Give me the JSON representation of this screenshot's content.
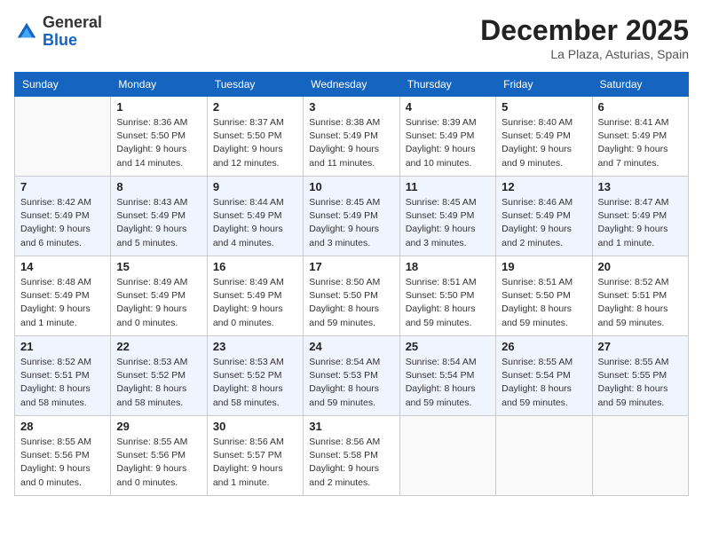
{
  "header": {
    "logo_general": "General",
    "logo_blue": "Blue",
    "month_title": "December 2025",
    "location": "La Plaza, Asturias, Spain"
  },
  "days_of_week": [
    "Sunday",
    "Monday",
    "Tuesday",
    "Wednesday",
    "Thursday",
    "Friday",
    "Saturday"
  ],
  "weeks": [
    [
      {
        "day": "",
        "sunrise": "",
        "sunset": "",
        "daylight": ""
      },
      {
        "day": "1",
        "sunrise": "Sunrise: 8:36 AM",
        "sunset": "Sunset: 5:50 PM",
        "daylight": "Daylight: 9 hours and 14 minutes."
      },
      {
        "day": "2",
        "sunrise": "Sunrise: 8:37 AM",
        "sunset": "Sunset: 5:50 PM",
        "daylight": "Daylight: 9 hours and 12 minutes."
      },
      {
        "day": "3",
        "sunrise": "Sunrise: 8:38 AM",
        "sunset": "Sunset: 5:49 PM",
        "daylight": "Daylight: 9 hours and 11 minutes."
      },
      {
        "day": "4",
        "sunrise": "Sunrise: 8:39 AM",
        "sunset": "Sunset: 5:49 PM",
        "daylight": "Daylight: 9 hours and 10 minutes."
      },
      {
        "day": "5",
        "sunrise": "Sunrise: 8:40 AM",
        "sunset": "Sunset: 5:49 PM",
        "daylight": "Daylight: 9 hours and 9 minutes."
      },
      {
        "day": "6",
        "sunrise": "Sunrise: 8:41 AM",
        "sunset": "Sunset: 5:49 PM",
        "daylight": "Daylight: 9 hours and 7 minutes."
      }
    ],
    [
      {
        "day": "7",
        "sunrise": "Sunrise: 8:42 AM",
        "sunset": "Sunset: 5:49 PM",
        "daylight": "Daylight: 9 hours and 6 minutes."
      },
      {
        "day": "8",
        "sunrise": "Sunrise: 8:43 AM",
        "sunset": "Sunset: 5:49 PM",
        "daylight": "Daylight: 9 hours and 5 minutes."
      },
      {
        "day": "9",
        "sunrise": "Sunrise: 8:44 AM",
        "sunset": "Sunset: 5:49 PM",
        "daylight": "Daylight: 9 hours and 4 minutes."
      },
      {
        "day": "10",
        "sunrise": "Sunrise: 8:45 AM",
        "sunset": "Sunset: 5:49 PM",
        "daylight": "Daylight: 9 hours and 3 minutes."
      },
      {
        "day": "11",
        "sunrise": "Sunrise: 8:45 AM",
        "sunset": "Sunset: 5:49 PM",
        "daylight": "Daylight: 9 hours and 3 minutes."
      },
      {
        "day": "12",
        "sunrise": "Sunrise: 8:46 AM",
        "sunset": "Sunset: 5:49 PM",
        "daylight": "Daylight: 9 hours and 2 minutes."
      },
      {
        "day": "13",
        "sunrise": "Sunrise: 8:47 AM",
        "sunset": "Sunset: 5:49 PM",
        "daylight": "Daylight: 9 hours and 1 minute."
      }
    ],
    [
      {
        "day": "14",
        "sunrise": "Sunrise: 8:48 AM",
        "sunset": "Sunset: 5:49 PM",
        "daylight": "Daylight: 9 hours and 1 minute."
      },
      {
        "day": "15",
        "sunrise": "Sunrise: 8:49 AM",
        "sunset": "Sunset: 5:49 PM",
        "daylight": "Daylight: 9 hours and 0 minutes."
      },
      {
        "day": "16",
        "sunrise": "Sunrise: 8:49 AM",
        "sunset": "Sunset: 5:49 PM",
        "daylight": "Daylight: 9 hours and 0 minutes."
      },
      {
        "day": "17",
        "sunrise": "Sunrise: 8:50 AM",
        "sunset": "Sunset: 5:50 PM",
        "daylight": "Daylight: 8 hours and 59 minutes."
      },
      {
        "day": "18",
        "sunrise": "Sunrise: 8:51 AM",
        "sunset": "Sunset: 5:50 PM",
        "daylight": "Daylight: 8 hours and 59 minutes."
      },
      {
        "day": "19",
        "sunrise": "Sunrise: 8:51 AM",
        "sunset": "Sunset: 5:50 PM",
        "daylight": "Daylight: 8 hours and 59 minutes."
      },
      {
        "day": "20",
        "sunrise": "Sunrise: 8:52 AM",
        "sunset": "Sunset: 5:51 PM",
        "daylight": "Daylight: 8 hours and 59 minutes."
      }
    ],
    [
      {
        "day": "21",
        "sunrise": "Sunrise: 8:52 AM",
        "sunset": "Sunset: 5:51 PM",
        "daylight": "Daylight: 8 hours and 58 minutes."
      },
      {
        "day": "22",
        "sunrise": "Sunrise: 8:53 AM",
        "sunset": "Sunset: 5:52 PM",
        "daylight": "Daylight: 8 hours and 58 minutes."
      },
      {
        "day": "23",
        "sunrise": "Sunrise: 8:53 AM",
        "sunset": "Sunset: 5:52 PM",
        "daylight": "Daylight: 8 hours and 58 minutes."
      },
      {
        "day": "24",
        "sunrise": "Sunrise: 8:54 AM",
        "sunset": "Sunset: 5:53 PM",
        "daylight": "Daylight: 8 hours and 59 minutes."
      },
      {
        "day": "25",
        "sunrise": "Sunrise: 8:54 AM",
        "sunset": "Sunset: 5:54 PM",
        "daylight": "Daylight: 8 hours and 59 minutes."
      },
      {
        "day": "26",
        "sunrise": "Sunrise: 8:55 AM",
        "sunset": "Sunset: 5:54 PM",
        "daylight": "Daylight: 8 hours and 59 minutes."
      },
      {
        "day": "27",
        "sunrise": "Sunrise: 8:55 AM",
        "sunset": "Sunset: 5:55 PM",
        "daylight": "Daylight: 8 hours and 59 minutes."
      }
    ],
    [
      {
        "day": "28",
        "sunrise": "Sunrise: 8:55 AM",
        "sunset": "Sunset: 5:56 PM",
        "daylight": "Daylight: 9 hours and 0 minutes."
      },
      {
        "day": "29",
        "sunrise": "Sunrise: 8:55 AM",
        "sunset": "Sunset: 5:56 PM",
        "daylight": "Daylight: 9 hours and 0 minutes."
      },
      {
        "day": "30",
        "sunrise": "Sunrise: 8:56 AM",
        "sunset": "Sunset: 5:57 PM",
        "daylight": "Daylight: 9 hours and 1 minute."
      },
      {
        "day": "31",
        "sunrise": "Sunrise: 8:56 AM",
        "sunset": "Sunset: 5:58 PM",
        "daylight": "Daylight: 9 hours and 2 minutes."
      },
      {
        "day": "",
        "sunrise": "",
        "sunset": "",
        "daylight": ""
      },
      {
        "day": "",
        "sunrise": "",
        "sunset": "",
        "daylight": ""
      },
      {
        "day": "",
        "sunrise": "",
        "sunset": "",
        "daylight": ""
      }
    ]
  ]
}
